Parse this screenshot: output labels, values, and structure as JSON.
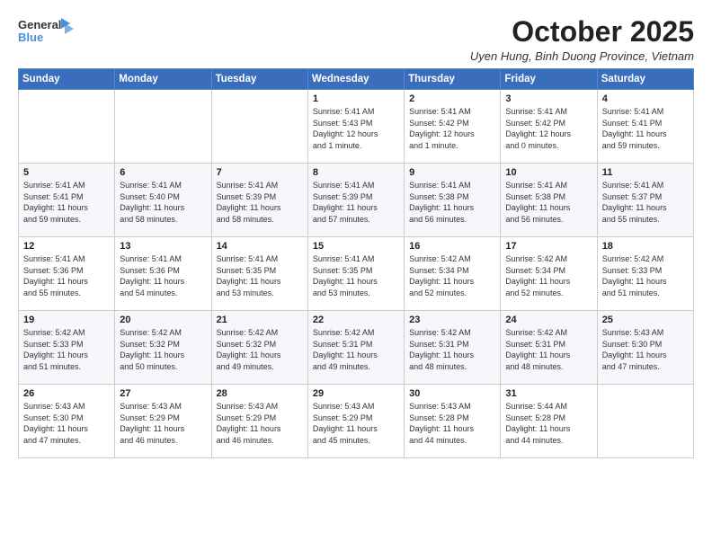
{
  "logo": {
    "line1": "General",
    "line2": "Blue"
  },
  "header": {
    "title": "October 2025",
    "subtitle": "Uyen Hung, Binh Duong Province, Vietnam"
  },
  "days": [
    "Sunday",
    "Monday",
    "Tuesday",
    "Wednesday",
    "Thursday",
    "Friday",
    "Saturday"
  ],
  "weeks": [
    [
      {
        "day": "",
        "content": ""
      },
      {
        "day": "",
        "content": ""
      },
      {
        "day": "",
        "content": ""
      },
      {
        "day": "1",
        "content": "Sunrise: 5:41 AM\nSunset: 5:43 PM\nDaylight: 12 hours\nand 1 minute."
      },
      {
        "day": "2",
        "content": "Sunrise: 5:41 AM\nSunset: 5:42 PM\nDaylight: 12 hours\nand 1 minute."
      },
      {
        "day": "3",
        "content": "Sunrise: 5:41 AM\nSunset: 5:42 PM\nDaylight: 12 hours\nand 0 minutes."
      },
      {
        "day": "4",
        "content": "Sunrise: 5:41 AM\nSunset: 5:41 PM\nDaylight: 11 hours\nand 59 minutes."
      }
    ],
    [
      {
        "day": "5",
        "content": "Sunrise: 5:41 AM\nSunset: 5:41 PM\nDaylight: 11 hours\nand 59 minutes."
      },
      {
        "day": "6",
        "content": "Sunrise: 5:41 AM\nSunset: 5:40 PM\nDaylight: 11 hours\nand 58 minutes."
      },
      {
        "day": "7",
        "content": "Sunrise: 5:41 AM\nSunset: 5:39 PM\nDaylight: 11 hours\nand 58 minutes."
      },
      {
        "day": "8",
        "content": "Sunrise: 5:41 AM\nSunset: 5:39 PM\nDaylight: 11 hours\nand 57 minutes."
      },
      {
        "day": "9",
        "content": "Sunrise: 5:41 AM\nSunset: 5:38 PM\nDaylight: 11 hours\nand 56 minutes."
      },
      {
        "day": "10",
        "content": "Sunrise: 5:41 AM\nSunset: 5:38 PM\nDaylight: 11 hours\nand 56 minutes."
      },
      {
        "day": "11",
        "content": "Sunrise: 5:41 AM\nSunset: 5:37 PM\nDaylight: 11 hours\nand 55 minutes."
      }
    ],
    [
      {
        "day": "12",
        "content": "Sunrise: 5:41 AM\nSunset: 5:36 PM\nDaylight: 11 hours\nand 55 minutes."
      },
      {
        "day": "13",
        "content": "Sunrise: 5:41 AM\nSunset: 5:36 PM\nDaylight: 11 hours\nand 54 minutes."
      },
      {
        "day": "14",
        "content": "Sunrise: 5:41 AM\nSunset: 5:35 PM\nDaylight: 11 hours\nand 53 minutes."
      },
      {
        "day": "15",
        "content": "Sunrise: 5:41 AM\nSunset: 5:35 PM\nDaylight: 11 hours\nand 53 minutes."
      },
      {
        "day": "16",
        "content": "Sunrise: 5:42 AM\nSunset: 5:34 PM\nDaylight: 11 hours\nand 52 minutes."
      },
      {
        "day": "17",
        "content": "Sunrise: 5:42 AM\nSunset: 5:34 PM\nDaylight: 11 hours\nand 52 minutes."
      },
      {
        "day": "18",
        "content": "Sunrise: 5:42 AM\nSunset: 5:33 PM\nDaylight: 11 hours\nand 51 minutes."
      }
    ],
    [
      {
        "day": "19",
        "content": "Sunrise: 5:42 AM\nSunset: 5:33 PM\nDaylight: 11 hours\nand 51 minutes."
      },
      {
        "day": "20",
        "content": "Sunrise: 5:42 AM\nSunset: 5:32 PM\nDaylight: 11 hours\nand 50 minutes."
      },
      {
        "day": "21",
        "content": "Sunrise: 5:42 AM\nSunset: 5:32 PM\nDaylight: 11 hours\nand 49 minutes."
      },
      {
        "day": "22",
        "content": "Sunrise: 5:42 AM\nSunset: 5:31 PM\nDaylight: 11 hours\nand 49 minutes."
      },
      {
        "day": "23",
        "content": "Sunrise: 5:42 AM\nSunset: 5:31 PM\nDaylight: 11 hours\nand 48 minutes."
      },
      {
        "day": "24",
        "content": "Sunrise: 5:42 AM\nSunset: 5:31 PM\nDaylight: 11 hours\nand 48 minutes."
      },
      {
        "day": "25",
        "content": "Sunrise: 5:43 AM\nSunset: 5:30 PM\nDaylight: 11 hours\nand 47 minutes."
      }
    ],
    [
      {
        "day": "26",
        "content": "Sunrise: 5:43 AM\nSunset: 5:30 PM\nDaylight: 11 hours\nand 47 minutes."
      },
      {
        "day": "27",
        "content": "Sunrise: 5:43 AM\nSunset: 5:29 PM\nDaylight: 11 hours\nand 46 minutes."
      },
      {
        "day": "28",
        "content": "Sunrise: 5:43 AM\nSunset: 5:29 PM\nDaylight: 11 hours\nand 46 minutes."
      },
      {
        "day": "29",
        "content": "Sunrise: 5:43 AM\nSunset: 5:29 PM\nDaylight: 11 hours\nand 45 minutes."
      },
      {
        "day": "30",
        "content": "Sunrise: 5:43 AM\nSunset: 5:28 PM\nDaylight: 11 hours\nand 44 minutes."
      },
      {
        "day": "31",
        "content": "Sunrise: 5:44 AM\nSunset: 5:28 PM\nDaylight: 11 hours\nand 44 minutes."
      },
      {
        "day": "",
        "content": ""
      }
    ]
  ]
}
